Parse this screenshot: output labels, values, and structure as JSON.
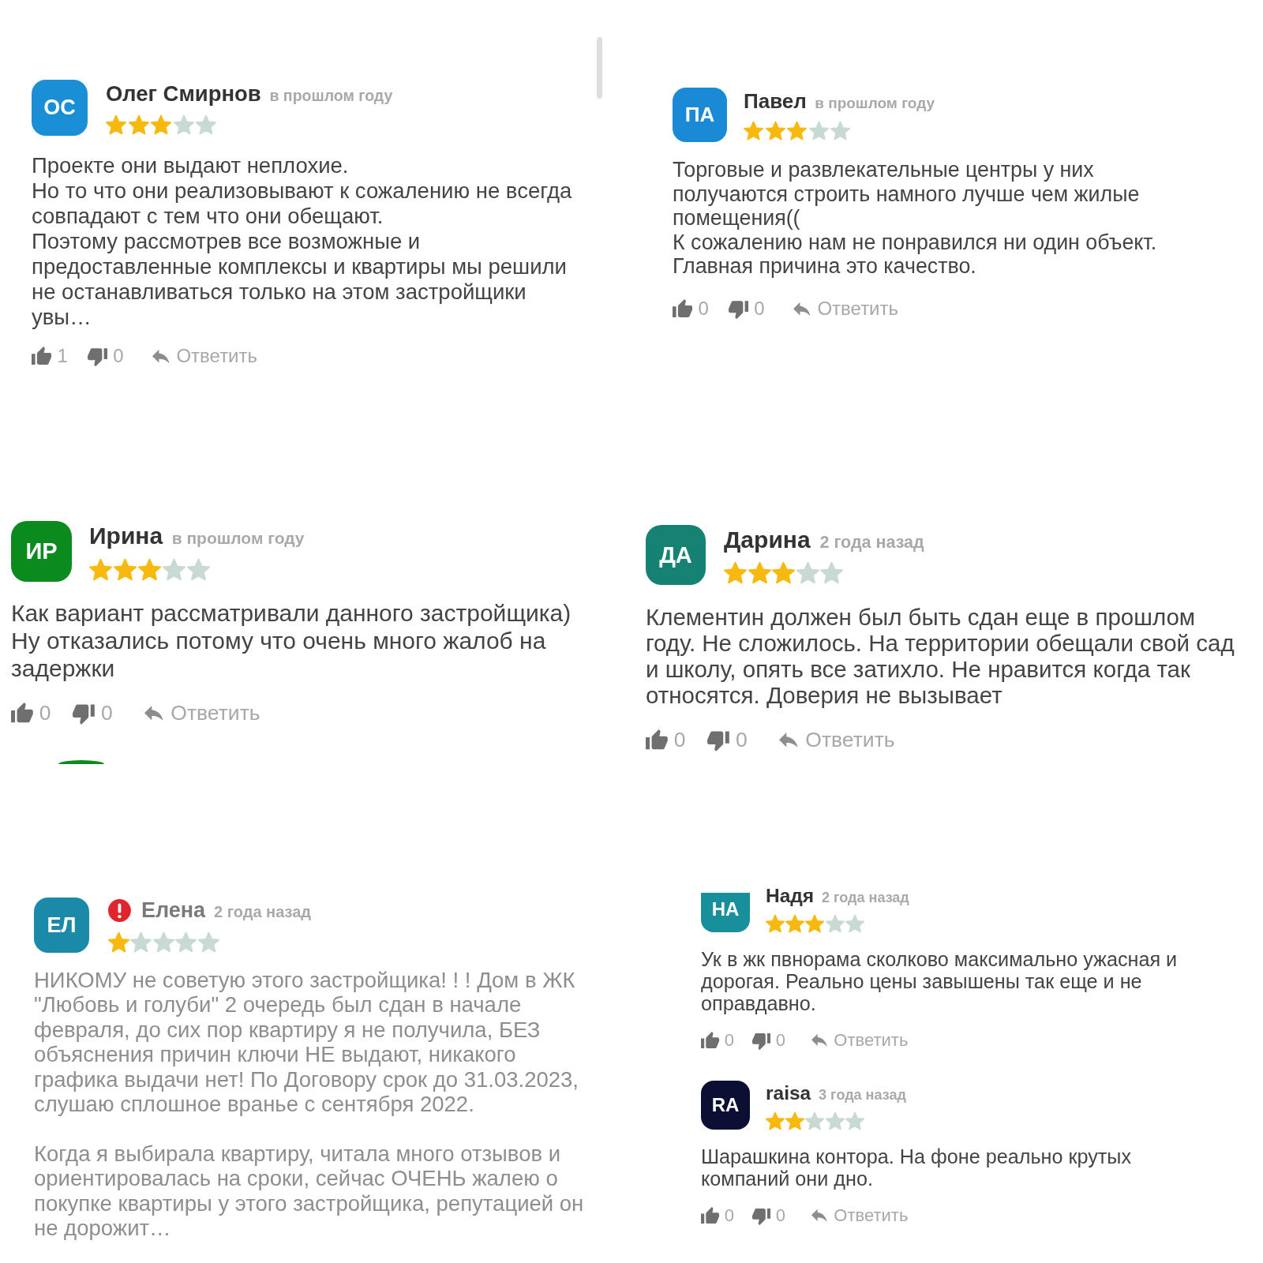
{
  "panels": [
    {
      "scrollbar": true,
      "reviews": [
        {
          "initials": "ОС",
          "color": "#1b8fd6",
          "name": "Олег Смирнов",
          "time": "в прошлом году",
          "stars": 3,
          "flagged": false,
          "text": "Проекте они выдают неплохие.\nНо то что они реализовывают к сожалению не всегда совпадают с тем что они обещают.\nПоэтому рассмотрев все возможные и предоставленные комплексы и квартиры мы решили не останавливаться только на этом застройщики увы…",
          "likes": "1",
          "dislikes": "0",
          "reply": "Ответить"
        }
      ]
    },
    {
      "reviews": [
        {
          "initials": "ПА",
          "color": "#1a8ad6",
          "name": "Павел",
          "time": "в прошлом году",
          "stars": 3,
          "flagged": false,
          "text": "Торговые и развлекательные центры у них получаются строить намного лучше чем жилые помещения((\nК сожалению нам не понравился ни один объект.\nГлавная причина это качество.",
          "likes": "0",
          "dislikes": "0",
          "reply": "Ответить"
        }
      ]
    },
    {
      "reviews": [
        {
          "initials": "ИР",
          "color": "#0b8a1e",
          "name": "Ирина",
          "time": "в прошлом году",
          "stars": 3,
          "flagged": false,
          "text": "Как вариант рассматривали данного застройщика)\nНу отказались потому что очень много жалоб на задержки",
          "likes": "0",
          "dislikes": "0",
          "reply": "Ответить"
        }
      ],
      "next_avatar": {
        "color": "#0b8a1e"
      }
    },
    {
      "reviews": [
        {
          "initials": "ДА",
          "color": "#168273",
          "name": "Дарина",
          "time": "2 года назад",
          "stars": 3,
          "flagged": false,
          "text": "Клементин должен был быть сдан еще в прошлом году. Не сложилось. На территории обещали свой сад и школу, опять все затихло. Не нравится когда так относятся. Доверия не вызывает",
          "likes": "0",
          "dislikes": "0",
          "reply": "Ответить"
        }
      ]
    },
    {
      "reviews": [
        {
          "initials": "ЕЛ",
          "color": "#1a8aa8",
          "name": "Елена",
          "time": "2 года назад",
          "stars": 1,
          "flagged": true,
          "text": "НИКОМУ не советую этого застройщика! ! ! Дом в ЖК \"Любовь и голуби\" 2 очередь был сдан в начале февраля, до сих пор квартиру я не получила, БЕЗ объяснения причин ключи НЕ выдают, никакого графика выдачи нет! По Договору срок до 31.03.2023, слушаю сплошное вранье с сентября 2022.\n\nКогда я выбирала квартиру, читала много отзывов и ориентировалась на сроки, сейчас ОЧЕНЬ жалею о покупке квартиры у этого застройщика, репутацией он не дорожит…"
        }
      ]
    },
    {
      "reviews": [
        {
          "initials": "НА",
          "color": "#17909c",
          "name": "Надя",
          "time": "2 года назад",
          "stars": 3,
          "flagged": false,
          "text": "Ук в жк пвнорама сколково максимально ужасная и дорогая. Реально цены завышены так еще и не оправдавно.",
          "likes": "0",
          "dislikes": "0",
          "reply": "Ответить"
        },
        {
          "initials": "RA",
          "color": "#0c0f33",
          "name": "raisa",
          "time": "3 года назад",
          "stars": 2,
          "flagged": false,
          "text": "Шарашкина контора. На фоне реально крутых компаний они дно.",
          "likes": "0",
          "dislikes": "0",
          "reply": "Ответить"
        }
      ]
    }
  ]
}
